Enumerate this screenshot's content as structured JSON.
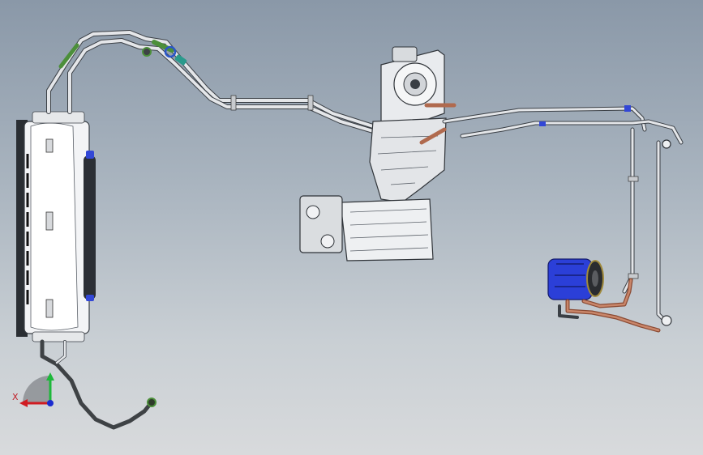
{
  "viewport": {
    "background_top": "#8a98a8",
    "background_bottom": "#d8dadc"
  },
  "triad": {
    "x_label": "X",
    "x_axis_color": "#d01b22",
    "y_axis_color": "#1db83a",
    "z_axis_color": "#1a2bd0"
  },
  "colors": {
    "line_stroke": "#3a3f45",
    "pipe_fill": "#dfe2e6",
    "hose_copper": "#b06a4e",
    "hose_dark": "#3e4245",
    "compressor_blue": "#2b3fd8",
    "connector_green": "#4c8f3a",
    "connector_teal": "#2a9a8c"
  },
  "icons": [
    "coordinate-triad-icon"
  ]
}
